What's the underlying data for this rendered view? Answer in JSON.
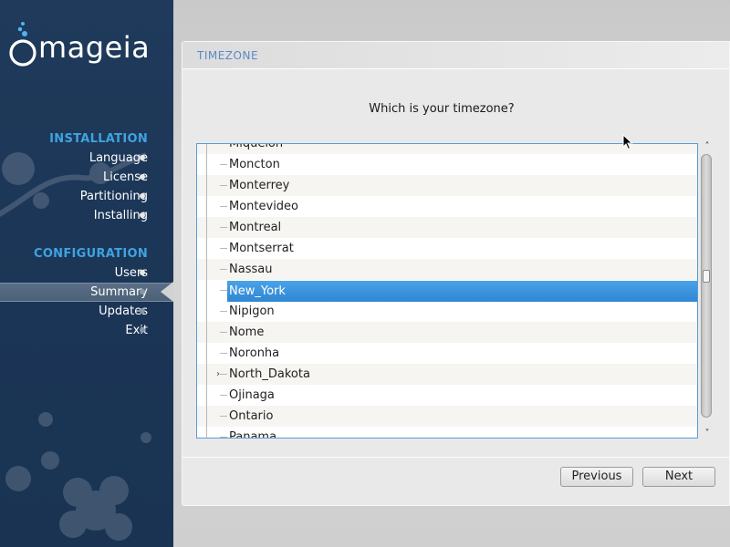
{
  "app": {
    "logo_text": "mageia"
  },
  "sidebar": {
    "sections": [
      {
        "header": "INSTALLATION",
        "steps": [
          {
            "label": "Language"
          },
          {
            "label": "License"
          },
          {
            "label": "Partitioning"
          },
          {
            "label": "Installing"
          }
        ]
      },
      {
        "header": "CONFIGURATION",
        "steps": [
          {
            "label": "Users"
          },
          {
            "label": "Summary"
          },
          {
            "label": "Updates"
          },
          {
            "label": "Exit"
          }
        ]
      }
    ],
    "current_step": "Summary"
  },
  "panel": {
    "title": "TIMEZONE",
    "prompt": "Which is your timezone?"
  },
  "timezone_list": {
    "items": [
      {
        "label": "Miquelon"
      },
      {
        "label": "Moncton"
      },
      {
        "label": "Monterrey"
      },
      {
        "label": "Montevideo"
      },
      {
        "label": "Montreal"
      },
      {
        "label": "Montserrat"
      },
      {
        "label": "Nassau"
      },
      {
        "label": "New_York",
        "selected": true
      },
      {
        "label": "Nipigon"
      },
      {
        "label": "Nome"
      },
      {
        "label": "Noronha"
      },
      {
        "label": "North_Dakota",
        "expandable": true
      },
      {
        "label": "Ojinaga"
      },
      {
        "label": "Ontario"
      },
      {
        "label": "Panama"
      }
    ],
    "selected": "New_York"
  },
  "buttons": {
    "previous": "Previous",
    "next": "Next"
  },
  "colors": {
    "sidebar_bg": "#1d375a",
    "section_header": "#3fa3e0",
    "selection": "#3a93dc",
    "title_text": "#5a8ac6"
  },
  "icons": {
    "logo": "mageia-logo-icon",
    "cursor": "mouse-pointer-icon",
    "expander": "chevron-right-icon",
    "scroll_up": "chevron-up-icon",
    "scroll_down": "chevron-down-icon"
  }
}
